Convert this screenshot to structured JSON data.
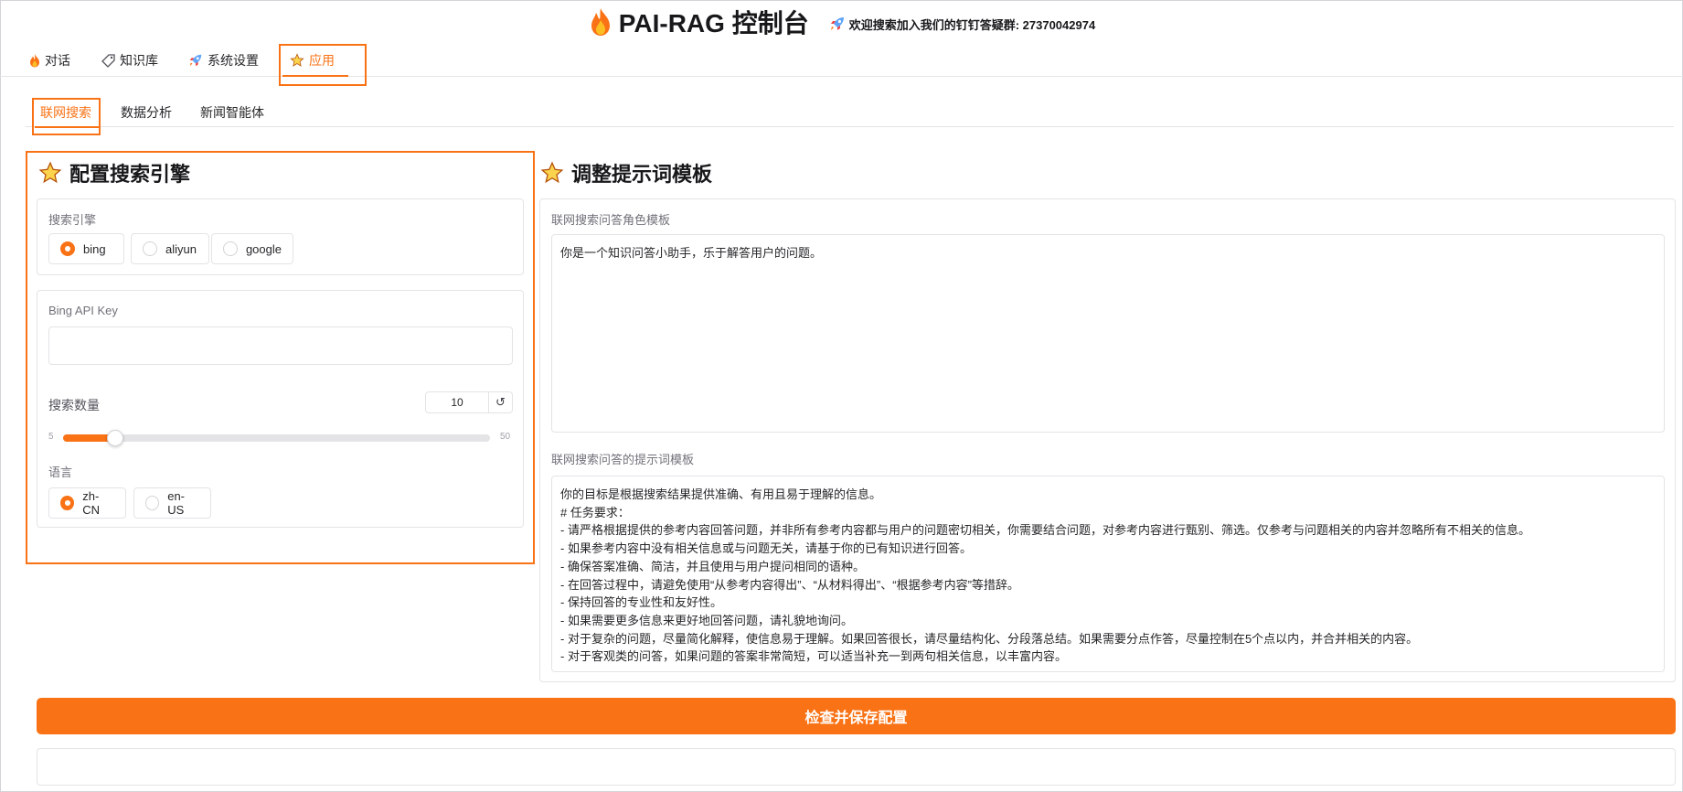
{
  "header": {
    "title": "PAI-RAG 控制台",
    "notice": "欢迎搜索加入我们的钉钉答疑群: 27370042974"
  },
  "main_tabs": [
    {
      "label": "对话",
      "icon": "fire-icon"
    },
    {
      "label": "知识库",
      "icon": "tag-icon"
    },
    {
      "label": "系统设置",
      "icon": "rocket-icon"
    },
    {
      "label": "应用",
      "icon": "star-icon",
      "active": true
    }
  ],
  "sub_tabs": [
    {
      "label": "联网搜索",
      "active": true
    },
    {
      "label": "数据分析"
    },
    {
      "label": "新闻智能体"
    }
  ],
  "left": {
    "title": "配置搜索引擎",
    "engine_label": "搜索引擎",
    "engines": [
      "bing",
      "aliyun",
      "google"
    ],
    "engine_selected": "bing",
    "api_key_label": "Bing API Key",
    "api_key_value": "",
    "count_label": "搜索数量",
    "count_value": "10",
    "count_min": "5",
    "count_max": "50",
    "lang_label": "语言",
    "langs": [
      "zh-CN",
      "en-US"
    ],
    "lang_selected": "zh-CN"
  },
  "right": {
    "title": "调整提示词模板",
    "role_label": "联网搜索问答角色模板",
    "role_value": "你是一个知识问答小助手，乐于解答用户的问题。",
    "prompt_label": "联网搜索问答的提示词模板",
    "prompt_lines": [
      "",
      "你的目标是根据搜索结果提供准确、有用且易于理解的信息。",
      "# 任务要求：",
      "- 请严格根据提供的参考内容回答问题，并非所有参考内容都与用户的问题密切相关，你需要结合问题，对参考内容进行甄别、筛选。仅参考与问题相关的内容并忽略所有不相关的信息。",
      "- 如果参考内容中没有相关信息或与问题无关，请基于你的已有知识进行回答。",
      "- 确保答案准确、简洁，并且使用与用户提问相同的语种。",
      "- 在回答过程中，请避免使用“从参考内容得出”、“从材料得出”、“根据参考内容”等措辞。",
      "- 保持回答的专业性和友好性。",
      "- 如果需要更多信息来更好地回答问题，请礼貌地询问。",
      "- 对于复杂的问题，尽量简化解释，使信息易于理解。如果回答很长，请尽量结构化、分段落总结。如果需要分点作答，尽量控制在5个点以内，并合并相关的内容。",
      "- 对于客观类的问答，如果问题的答案非常简短，可以适当补充一到两句相关信息，以丰富内容。"
    ]
  },
  "save_button": "检查并保存配置",
  "colors": {
    "accent": "#f97316",
    "border": "#e4e4e7"
  }
}
